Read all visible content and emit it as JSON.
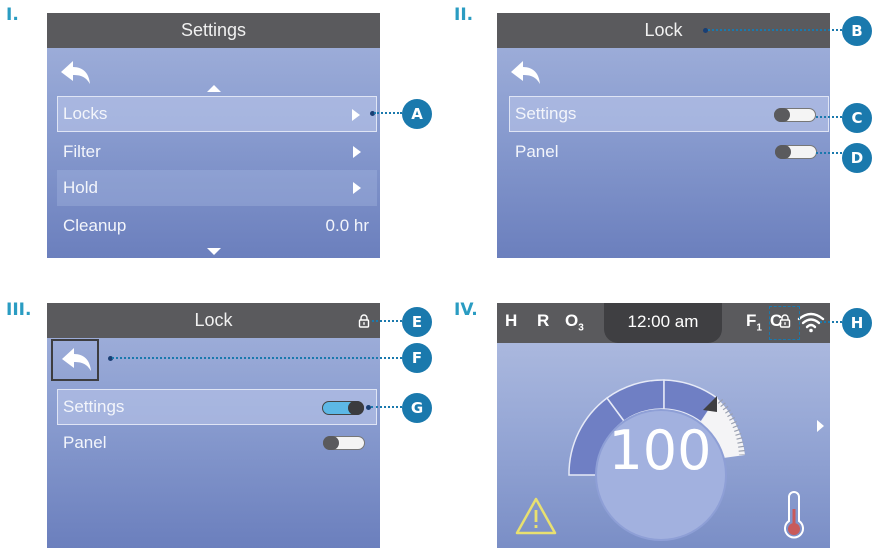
{
  "panel_labels": [
    "I.",
    "II.",
    "III.",
    "IV."
  ],
  "screen1": {
    "title": "Settings",
    "rows": [
      {
        "label": "Locks",
        "value": ""
      },
      {
        "label": "Filter",
        "value": ""
      },
      {
        "label": "Hold",
        "value": ""
      },
      {
        "label": "Cleanup",
        "value": "0.0 hr"
      }
    ]
  },
  "screen2": {
    "title": "Lock",
    "rows": [
      {
        "label": "Settings",
        "toggle": "off"
      },
      {
        "label": "Panel",
        "toggle": "off"
      }
    ]
  },
  "screen3": {
    "title": "Lock",
    "rows": [
      {
        "label": "Settings",
        "toggle": "on"
      },
      {
        "label": "Panel",
        "toggle": "off"
      }
    ]
  },
  "screen4": {
    "status_left": [
      "H",
      "R",
      "O"
    ],
    "ozone_subscript": "3",
    "time": "12:00 am",
    "status_right_f": "F",
    "f_subscript": "1",
    "status_right_c": "C",
    "temperature": "100"
  },
  "callouts": [
    "A",
    "B",
    "C",
    "D",
    "E",
    "F",
    "G",
    "H"
  ],
  "icons": {
    "back": "back-arrow-icon",
    "lock": "lock-icon",
    "wifi": "wifi-icon",
    "warning": "warning-icon",
    "thermometer": "thermometer-icon"
  },
  "colors": {
    "label_accent": "#2a9cc2",
    "callout": "#1a79ad",
    "titlebar": "#5a5a5d",
    "toggle_on": "#5db8e6"
  }
}
